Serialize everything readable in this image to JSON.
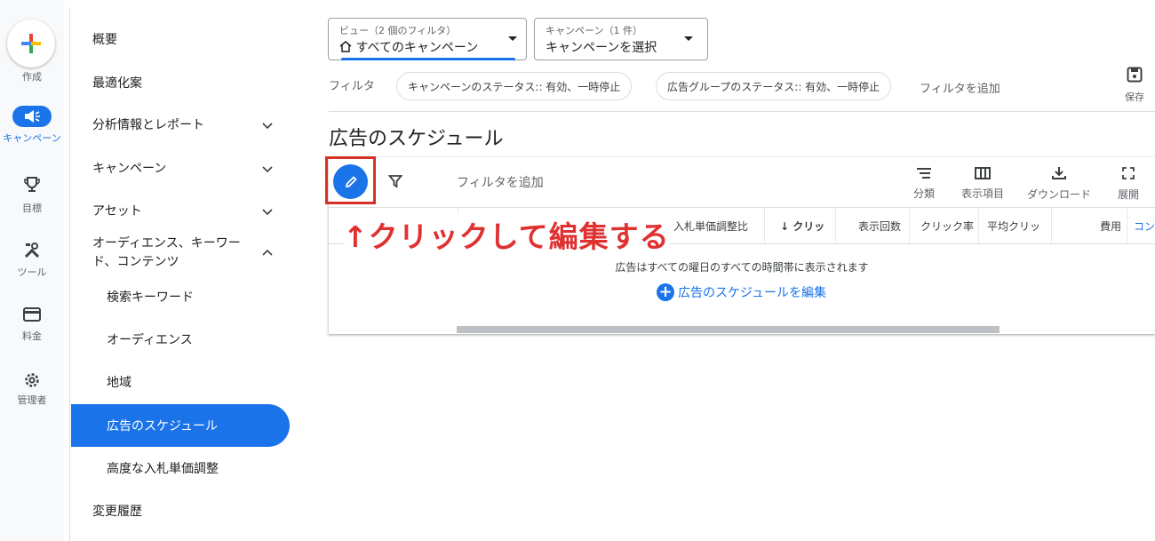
{
  "rail": {
    "create_label": "作成",
    "campaign_label": "キャンペーン",
    "goals_label": "目標",
    "tools_label": "ツール",
    "billing_label": "料金",
    "admin_label": "管理者"
  },
  "nav": {
    "overview": "概要",
    "recommendations": "最適化案",
    "insights": "分析情報とレポート",
    "campaigns": "キャンペーン",
    "assets": "アセット",
    "audiences_line1": "オーディエンス、キーワー",
    "audiences_line2": "ド、コンテンツ",
    "search_keywords": "検索キーワード",
    "audiences": "オーディエンス",
    "locations": "地域",
    "ad_schedule": "広告のスケジュール",
    "advanced_bid": "高度な入札単価調整",
    "change_history": "変更履歴"
  },
  "selectors": {
    "view_small": "ビュー（2 個のフィルタ）",
    "view_main": "すべてのキャンペーン",
    "campaign_small": "キャンペーン（1 件）",
    "campaign_main": "キャンペーンを選択"
  },
  "filters": {
    "label": "フィルタ",
    "chip1": "キャンペーンのステータス:: 有効、一時停止",
    "chip2": "広告グループのステータス:: 有効、一時停止",
    "add": "フィルタを追加",
    "save": "保存"
  },
  "page": {
    "title": "広告のスケジュール"
  },
  "toolbar": {
    "add_filter": "フィルタを追加",
    "segment": "分類",
    "columns": "表示項目",
    "download": "ダウンロード",
    "expand": "展開"
  },
  "table": {
    "headers": [
      "入札単価調整比",
      "↓ クリッ",
      "表示回数",
      "クリック率",
      "平均クリッ",
      "費用",
      "コン"
    ]
  },
  "annotation": "↑クリックして編集する",
  "empty": {
    "message": "広告はすべての曜日のすべての時間帯に表示されます",
    "edit_link": "広告のスケジュールを編集"
  },
  "colors": {
    "accent": "#1a73e8",
    "annotation": "#e03131"
  }
}
